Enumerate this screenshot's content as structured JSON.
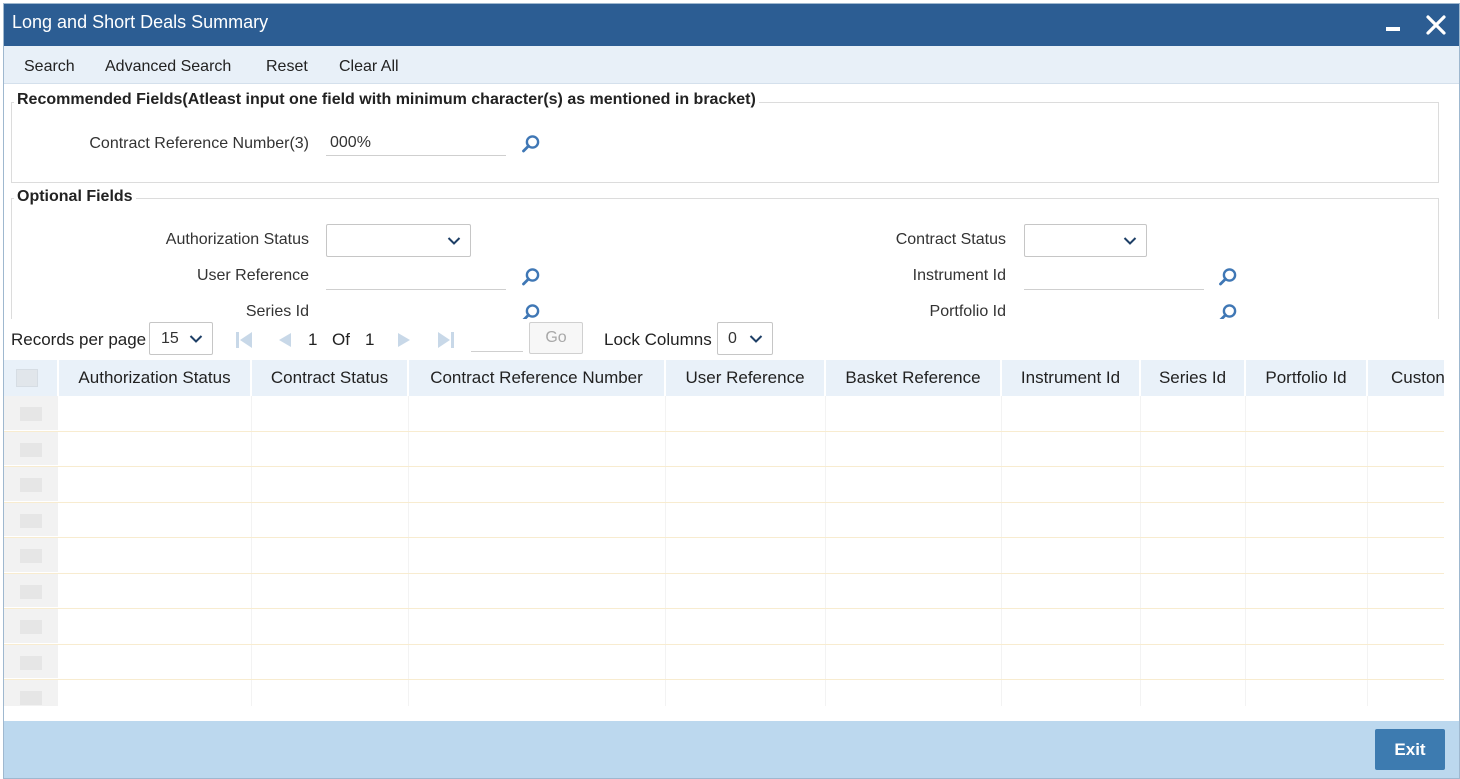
{
  "window": {
    "title": "Long and Short Deals Summary"
  },
  "toolbar": {
    "search": "Search",
    "advanced_search": "Advanced Search",
    "reset": "Reset",
    "clear_all": "Clear All"
  },
  "recommended": {
    "legend": "Recommended Fields(Atleast input one field with minimum character(s) as mentioned in bracket)",
    "contract_ref_label": "Contract Reference Number(3)",
    "contract_ref_value": "000%"
  },
  "optional": {
    "legend": "Optional Fields",
    "authorization_status_label": "Authorization Status",
    "authorization_status_value": "",
    "contract_status_label": "Contract Status",
    "contract_status_value": "",
    "user_reference_label": "User Reference",
    "user_reference_value": "",
    "instrument_id_label": "Instrument Id",
    "instrument_id_value": "",
    "series_id_label": "Series Id",
    "portfolio_id_label": "Portfolio Id"
  },
  "pager": {
    "records_per_page_label": "Records per page",
    "records_per_page_value": "15",
    "current_page": "1",
    "of_label": "Of",
    "total_pages": "1",
    "go_label": "Go",
    "lock_columns_label": "Lock Columns",
    "lock_columns_value": "0"
  },
  "grid": {
    "columns": [
      "Authorization Status",
      "Contract Status",
      "Contract Reference Number",
      "User Reference",
      "Basket Reference",
      "Instrument Id",
      "Series Id",
      "Portfolio Id",
      "Custon"
    ],
    "empty_rows": 9
  },
  "footer": {
    "exit_label": "Exit"
  },
  "colors": {
    "titlebar": "#2c5d93",
    "toolbar": "#e8f0f8",
    "grid_header": "#e9f1f9",
    "footer": "#bcd8ee",
    "exit_button": "#3d7bb0",
    "icon_blue": "#3f77b5"
  }
}
